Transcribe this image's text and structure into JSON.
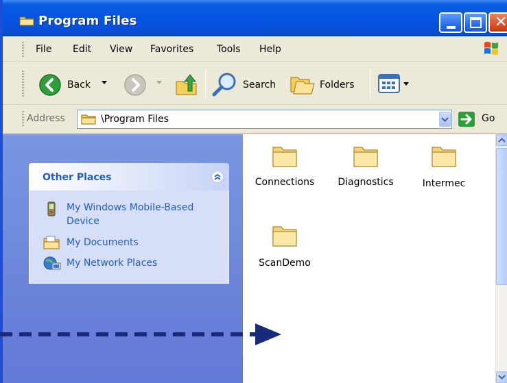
{
  "window": {
    "title": "Program Files"
  },
  "menu": [
    "File",
    "Edit",
    "View",
    "Favorites",
    "Tools",
    "Help"
  ],
  "toolbar": {
    "back_label": "Back",
    "search_label": "Search",
    "folders_label": "Folders"
  },
  "address": {
    "label": "Address",
    "value": "\\Program Files",
    "go_label": "Go"
  },
  "task_pane": {
    "title": "Other Places",
    "places": [
      {
        "label": "My Windows Mobile-Based Device",
        "icon": "mobile-device-icon"
      },
      {
        "label": "My Documents",
        "icon": "my-documents-icon"
      },
      {
        "label": "My Network Places",
        "icon": "network-places-icon"
      }
    ]
  },
  "files": [
    {
      "name": "Connections",
      "icon": "folder-icon"
    },
    {
      "name": "Diagnostics",
      "icon": "folder-icon"
    },
    {
      "name": "Intermec",
      "icon": "folder-icon"
    },
    {
      "name": "ScanDemo",
      "icon": "folder-icon"
    }
  ],
  "colors": {
    "titlebar": "#0554e3",
    "task_pane": "#6f88dc",
    "link": "#215dc6",
    "arrow": "#1a2a7a"
  }
}
